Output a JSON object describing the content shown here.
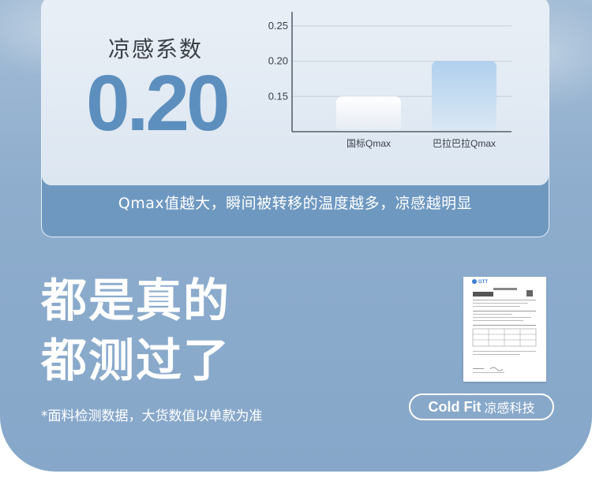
{
  "card": {
    "coefficient_title": "凉感系数",
    "coefficient_value": "0.20",
    "note": "Qmax值越大，瞬间被转移的温度越多，凉感越明显"
  },
  "chart_data": {
    "type": "bar",
    "categories": [
      "国标Qmax",
      "巴拉巴拉Qmax"
    ],
    "values": [
      0.15,
      0.2
    ],
    "yticks": [
      "0.15",
      "0.20",
      "0.25"
    ],
    "ylim": [
      0.1,
      0.27
    ],
    "grid": true,
    "colors": [
      "#f2f5f9",
      "#bcd6ee"
    ]
  },
  "headline": {
    "line1": "都是真的",
    "line2": "都测过了"
  },
  "footnote": "*面料检测数据，大货数值以单款为准",
  "badge": {
    "brand": "Cold Fit",
    "label": "凉感科技"
  },
  "report": {
    "logo": "GTT",
    "image": "test-report-document"
  },
  "colors": {
    "accent": "#5d8fbe",
    "background": "#8eadcd",
    "band": "#6e98c0"
  }
}
